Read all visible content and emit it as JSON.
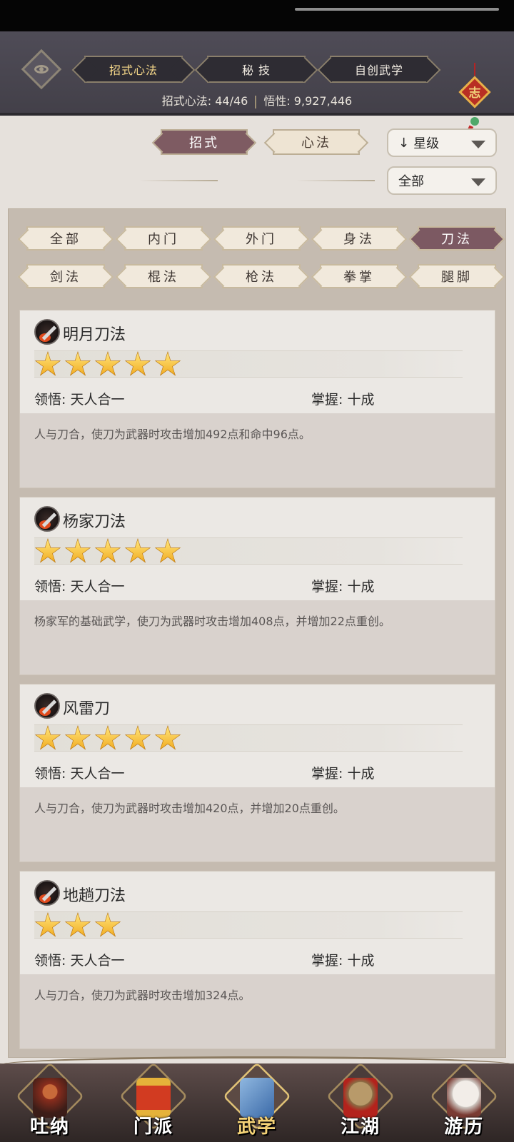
{
  "header": {
    "tabs": [
      {
        "label": "招式心法",
        "active": true
      },
      {
        "label": "秘 技",
        "active": false
      },
      {
        "label": "自创武学",
        "active": false
      }
    ],
    "summary_label": "招式心法: 44/46",
    "insight_label": "悟性: 9,927,446",
    "knot_char": "志"
  },
  "subtabs": [
    {
      "label": "招式",
      "active": true
    },
    {
      "label": "心法",
      "active": false
    }
  ],
  "sort_dropdown": {
    "icon": "↓",
    "label": "星级"
  },
  "filter_dropdown": {
    "label": "全部"
  },
  "categories": [
    {
      "label": "全部",
      "active": false
    },
    {
      "label": "内门",
      "active": false
    },
    {
      "label": "外门",
      "active": false
    },
    {
      "label": "身法",
      "active": false
    },
    {
      "label": "刀法",
      "active": true
    },
    {
      "label": "剑法",
      "active": false
    },
    {
      "label": "棍法",
      "active": false
    },
    {
      "label": "枪法",
      "active": false
    },
    {
      "label": "拳掌",
      "active": false
    },
    {
      "label": "腿脚",
      "active": false
    }
  ],
  "skills": [
    {
      "name": "明月刀法",
      "stars": 5,
      "comprehension": "领悟: 天人合一",
      "mastery": "掌握: 十成",
      "desc": "人与刀合，使刀为武器时攻击增加492点和命中96点。"
    },
    {
      "name": "杨家刀法",
      "stars": 5,
      "comprehension": "领悟: 天人合一",
      "mastery": "掌握: 十成",
      "desc": "杨家军的基础武学，使刀为武器时攻击增加408点，并增加22点重创。"
    },
    {
      "name": "风雷刀",
      "stars": 5,
      "comprehension": "领悟: 天人合一",
      "mastery": "掌握: 十成",
      "desc": "人与刀合，使刀为武器时攻击增加420点，并增加20点重创。"
    },
    {
      "name": "地趟刀法",
      "stars": 3,
      "comprehension": "领悟: 天人合一",
      "mastery": "掌握: 十成",
      "desc": "人与刀合，使刀为武器时攻击增加324点。"
    }
  ],
  "nav": [
    {
      "label": "吐纳",
      "icon": "monk-icon",
      "active": false
    },
    {
      "label": "门派",
      "icon": "banner-icon",
      "active": false
    },
    {
      "label": "武学",
      "icon": "book-icon",
      "active": true
    },
    {
      "label": "江湖",
      "icon": "hat-icon",
      "active": false
    },
    {
      "label": "游历",
      "icon": "horse-icon",
      "active": false
    }
  ],
  "colors": {
    "active_tab": "#7e5b62",
    "topbar": "#4a4750",
    "star": "#f0a81c",
    "nav_active": "#f5d377"
  }
}
